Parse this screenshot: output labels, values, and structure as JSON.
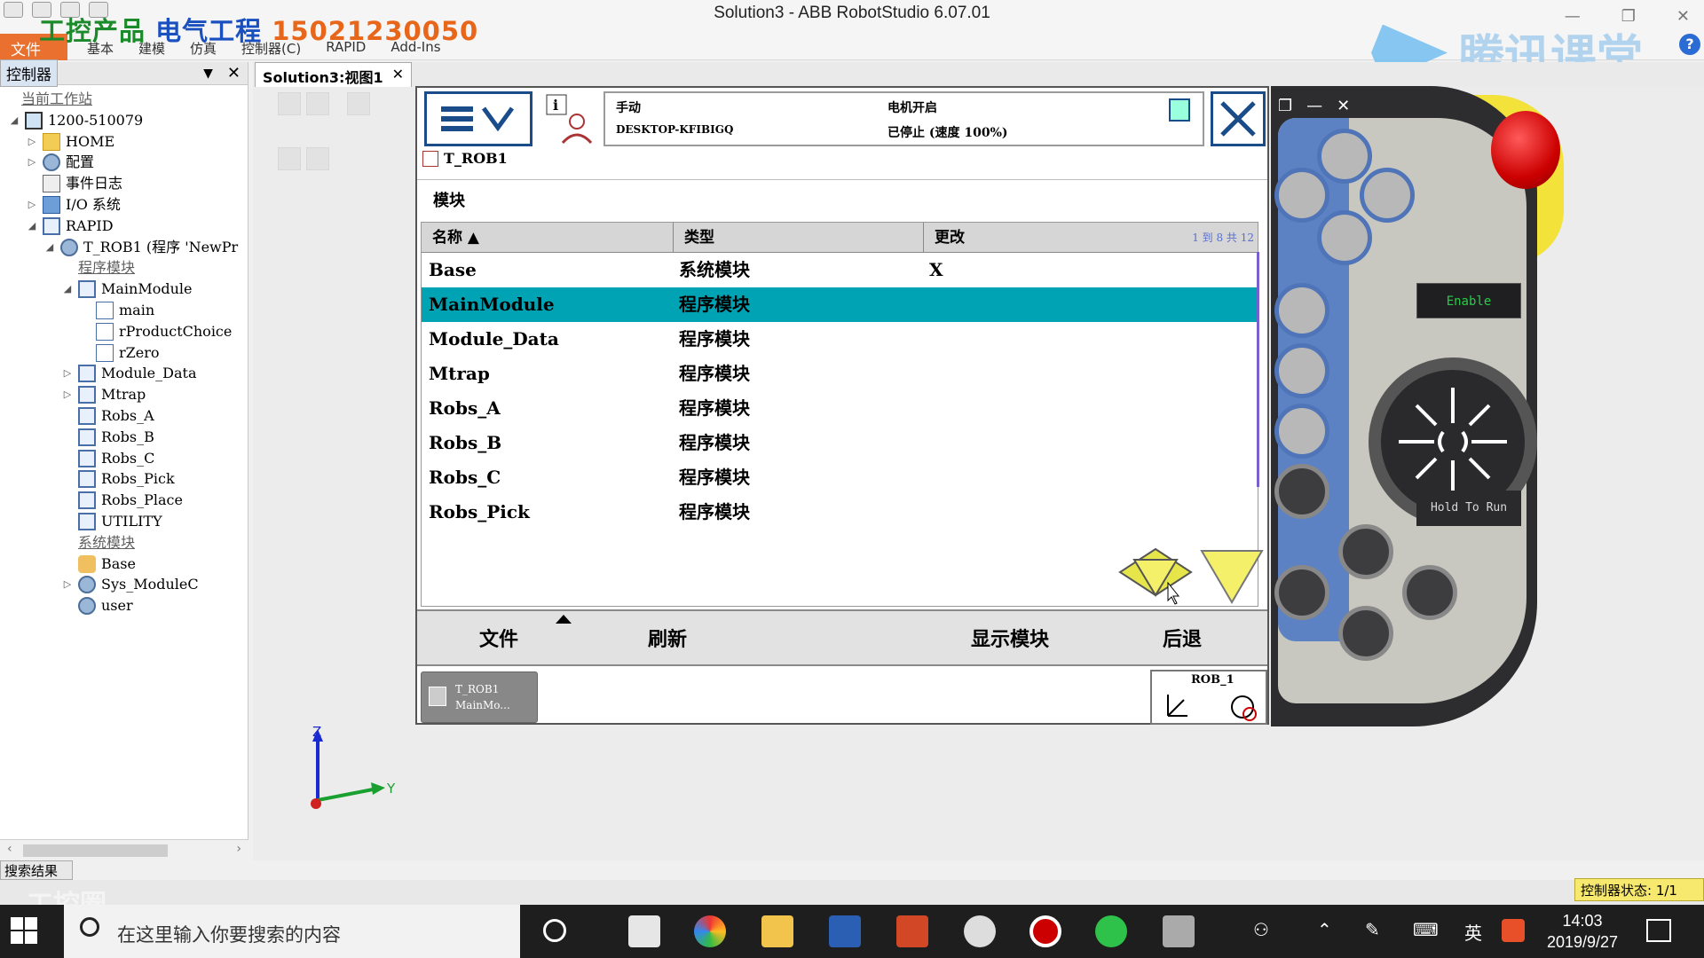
{
  "window": {
    "title": "Solution3 - ABB RobotStudio 6.07.01",
    "file_tab": "文件 (F)",
    "ribbon_tabs": [
      "基本",
      "建模",
      "仿真",
      "控制器(C)",
      "RAPID",
      "Add-Ins"
    ],
    "watermark_parts": [
      "工控产品",
      "电气工程",
      "15021230050"
    ],
    "brand_watermark": "腾讯课堂",
    "controls": [
      "—",
      "❐",
      "✕"
    ],
    "help": "?"
  },
  "left_panel": {
    "tab": "控制器",
    "pin": "▼",
    "close": "✕",
    "tree": [
      {
        "label": "当前工作站",
        "depth": 0,
        "underline": true
      },
      {
        "label": "1200-510079",
        "depth": 0,
        "arrow": "◢",
        "icon": "pc"
      },
      {
        "label": "HOME",
        "depth": 1,
        "arrow": "▷",
        "icon": "folder"
      },
      {
        "label": "配置",
        "depth": 1,
        "arrow": "▷",
        "icon": "gear"
      },
      {
        "label": "事件日志",
        "depth": 1,
        "arrow": "",
        "icon": "log"
      },
      {
        "label": "I/O 系统",
        "depth": 1,
        "arrow": "▷",
        "icon": "io"
      },
      {
        "label": "RAPID",
        "depth": 1,
        "arrow": "◢",
        "icon": "mod"
      },
      {
        "label": "T_ROB1 (程序 'NewPr",
        "depth": 2,
        "arrow": "◢",
        "icon": "gear"
      },
      {
        "label": "程序模块",
        "depth": 3,
        "underline": true
      },
      {
        "label": "MainModule",
        "depth": 3,
        "arrow": "◢",
        "icon": "mod"
      },
      {
        "label": "main",
        "depth": 4,
        "arrow": "",
        "icon": "proc"
      },
      {
        "label": "rProductChoice",
        "depth": 4,
        "arrow": "",
        "icon": "proc"
      },
      {
        "label": "rZero",
        "depth": 4,
        "arrow": "",
        "icon": "proc"
      },
      {
        "label": "Module_Data",
        "depth": 3,
        "arrow": "▷",
        "icon": "mod"
      },
      {
        "label": "Mtrap",
        "depth": 3,
        "arrow": "▷",
        "icon": "mod"
      },
      {
        "label": "Robs_A",
        "depth": 3,
        "arrow": "",
        "icon": "mod"
      },
      {
        "label": "Robs_B",
        "depth": 3,
        "arrow": "",
        "icon": "mod"
      },
      {
        "label": "Robs_C",
        "depth": 3,
        "arrow": "",
        "icon": "mod"
      },
      {
        "label": "Robs_Pick",
        "depth": 3,
        "arrow": "",
        "icon": "mod"
      },
      {
        "label": "Robs_Place",
        "depth": 3,
        "arrow": "",
        "icon": "mod"
      },
      {
        "label": "UTILITY",
        "depth": 3,
        "arrow": "",
        "icon": "mod"
      },
      {
        "label": "系统模块",
        "depth": 3,
        "underline": true
      },
      {
        "label": "Base",
        "depth": 3,
        "arrow": "",
        "icon": "hand"
      },
      {
        "label": "Sys_ModuleC",
        "depth": 3,
        "arrow": "▷",
        "icon": "gear"
      },
      {
        "label": "user",
        "depth": 3,
        "arrow": "",
        "icon": "gear"
      }
    ]
  },
  "doc_tab": {
    "label": "Solution3:视图1",
    "close": "✕"
  },
  "axes": {
    "z": "Z",
    "y": "Y"
  },
  "pendant": {
    "status": {
      "mode": "手动",
      "host": "DESKTOP-KFIBIGQ",
      "motor": "电机开启",
      "state": "已停止 (速度 100%)"
    },
    "crumb": "T_ROB1",
    "section_title": "模块",
    "columns": [
      "名称",
      "类型",
      "更改"
    ],
    "pages": "1 到 8 共 12",
    "rows": [
      {
        "name": "Base",
        "type": "系统模块",
        "changed": "X",
        "selected": false
      },
      {
        "name": "MainModule",
        "type": "程序模块",
        "changed": "",
        "selected": true
      },
      {
        "name": "Module_Data",
        "type": "程序模块",
        "changed": "",
        "selected": false
      },
      {
        "name": "Mtrap",
        "type": "程序模块",
        "changed": "",
        "selected": false
      },
      {
        "name": "Robs_A",
        "type": "程序模块",
        "changed": "",
        "selected": false
      },
      {
        "name": "Robs_B",
        "type": "程序模块",
        "changed": "",
        "selected": false
      },
      {
        "name": "Robs_C",
        "type": "程序模块",
        "changed": "",
        "selected": false
      },
      {
        "name": "Robs_Pick",
        "type": "程序模块",
        "changed": "",
        "selected": false
      }
    ],
    "toolbar": {
      "file": "文件",
      "refresh": "刷新",
      "show_module": "显示模块",
      "back": "后退"
    },
    "task": {
      "line1": "T_ROB1",
      "line2": "MainMo..."
    },
    "rob": "ROB_1",
    "hw": {
      "enable": "Enable",
      "hold": "Hold To Run"
    },
    "colors": {
      "selected_row": "#00a3b3",
      "accent": "#1a4c8a",
      "scroll_arrow": "#f5f06a"
    }
  },
  "bottom": {
    "search_results": "搜索结果",
    "controller_status": "控制器状态: 1/1",
    "watermark": "工控圈"
  },
  "taskbar": {
    "search_placeholder": "在这里输入你要搜索的内容",
    "ime": "英",
    "time": "14:03",
    "date": "2019/9/27"
  }
}
